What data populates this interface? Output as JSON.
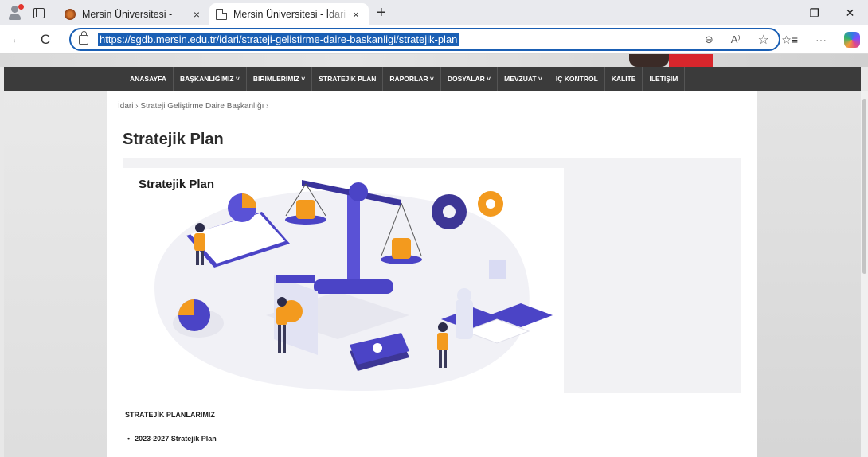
{
  "browser": {
    "tabs": [
      {
        "title": "Mersin Üniversitesi -",
        "close": "×"
      },
      {
        "title": "Mersin Üniversitesi - İdari - Stratejik Plan",
        "close": "×"
      }
    ],
    "new_tab": "+",
    "window_controls": {
      "minimize": "—",
      "restore": "❐",
      "close": "✕"
    },
    "nav": {
      "back": "←",
      "reload": "C"
    },
    "url": "https://sgdb.mersin.edu.tr/idari/strateji-gelistirme-daire-baskanligi/stratejik-plan",
    "address_icons": {
      "zoom": "⊖",
      "read_aloud": "A⁾",
      "favorite": "☆"
    },
    "toolbar_icons": {
      "favorites": "☆≡",
      "more": "···"
    }
  },
  "site": {
    "menu": [
      "ANASAYFA",
      "BAŞKANLIĞIMIZ ˅",
      "BİRİMLERİMİZ ˅",
      "STRATEJİK PLAN",
      "RAPORLAR ˅",
      "DOSYALAR ˅",
      "MEVZUAT ˅",
      "İÇ KONTROL",
      "KALİTE",
      "İLETİŞİM"
    ],
    "breadcrumb": "İdari › Strateji Geliştirme Daire Başkanlığı ›",
    "page_title": "Stratejik Plan",
    "illustration_title": "Stratejik Plan",
    "section_heading": "STRATEJİK PLANLARIMIZ",
    "plans": [
      "2023-2027 Stratejik Plan"
    ]
  },
  "colors": {
    "nav_bg": "#3b3b3b",
    "accent_indigo": "#4b44c6",
    "accent_orange": "#f39a1e",
    "address_focus": "#1a5fb4"
  }
}
